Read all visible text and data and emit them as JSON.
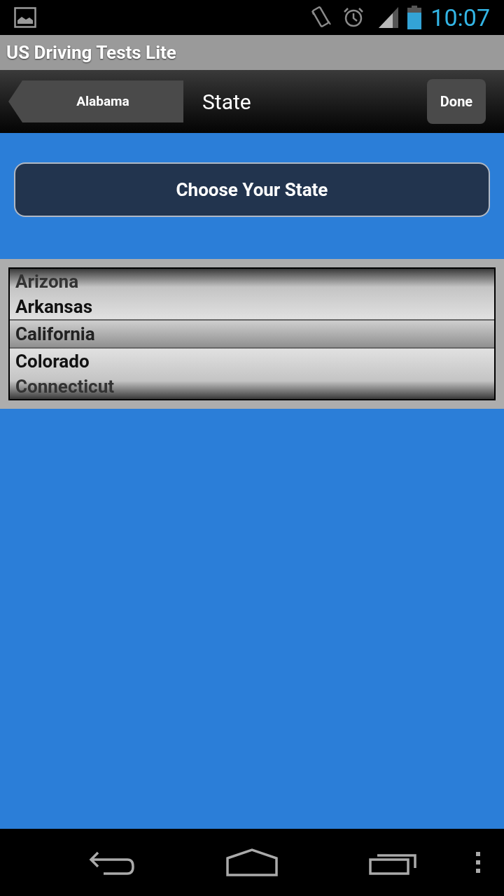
{
  "status_bar": {
    "time": "10:07"
  },
  "app_title": "US Driving Tests Lite",
  "nav": {
    "back": "Alabama",
    "title": "State",
    "done": "Done"
  },
  "choose_button": "Choose Your State",
  "picker": [
    {
      "label": "Arizona",
      "selected": false
    },
    {
      "label": "Arkansas",
      "selected": false
    },
    {
      "label": "California",
      "selected": true
    },
    {
      "label": "Colorado",
      "selected": false
    },
    {
      "label": "Connecticut",
      "selected": false
    }
  ]
}
